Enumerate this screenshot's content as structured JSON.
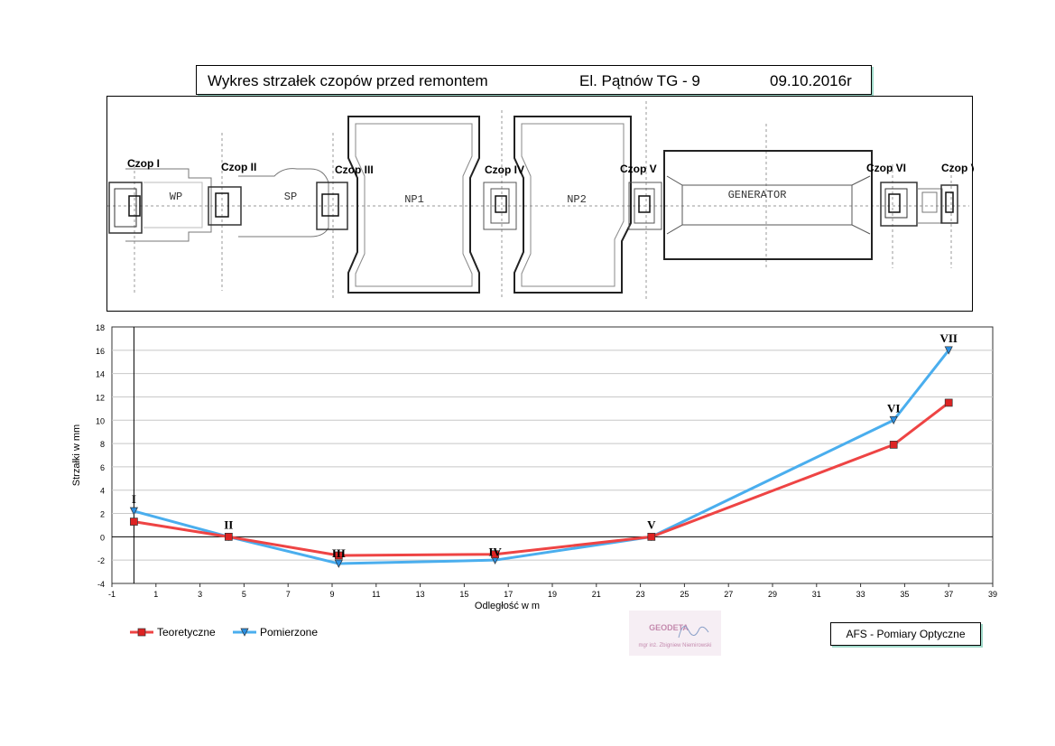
{
  "header": {
    "title": "Wykres strzałek czopów przed remontem",
    "machine": "El. Pątnów  TG - 9",
    "date": "09.10.2016r"
  },
  "diagram": {
    "journals": [
      "Czop I",
      "Czop II",
      "Czop III",
      "Czop IV",
      "Czop V",
      "Czop VI",
      "Czop VII"
    ],
    "sections": [
      "WP",
      "SP",
      "NP1",
      "NP2",
      "GENERATOR"
    ]
  },
  "chart_data": {
    "type": "line",
    "xlabel": "Odległość w m",
    "ylabel": "Strzałki w mm",
    "xlim": [
      -1,
      39
    ],
    "ylim": [
      -4,
      18
    ],
    "xticks": [
      -1,
      1,
      3,
      5,
      7,
      9,
      11,
      13,
      15,
      17,
      19,
      21,
      23,
      25,
      27,
      29,
      31,
      33,
      35,
      37,
      39
    ],
    "yticks": [
      -4,
      -2,
      0,
      2,
      4,
      6,
      8,
      10,
      12,
      14,
      16,
      18
    ],
    "grid": true,
    "point_labels": [
      "I",
      "II",
      "III",
      "IV",
      "V",
      "VI",
      "VII"
    ],
    "series": [
      {
        "name": "Teoretyczne",
        "color": "#ee4444",
        "marker": "square",
        "x": [
          0,
          4.3,
          9.3,
          16.4,
          23.5,
          34.5,
          37
        ],
        "y": [
          1.3,
          0,
          -1.6,
          -1.5,
          0,
          7.9,
          11.5
        ]
      },
      {
        "name": "Pomierzone",
        "color": "#4aaeee",
        "marker": "triangle-down",
        "x": [
          0,
          4.3,
          9.3,
          16.4,
          23.5,
          34.5,
          37
        ],
        "y": [
          2.2,
          0,
          -2.3,
          -2.0,
          0,
          10.0,
          16.0
        ]
      }
    ]
  },
  "footer": {
    "company": "AFS - Pomiary Optyczne",
    "stamp_title": "GEODETA",
    "stamp_name": "mgr inż. Zbigniew Niemirowski"
  }
}
